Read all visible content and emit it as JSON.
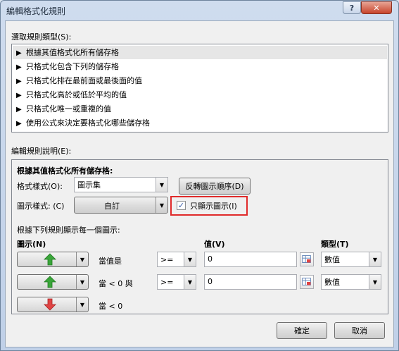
{
  "window": {
    "title": "編輯格式化規則",
    "help_label": "?",
    "close_label": "✕"
  },
  "rule_type": {
    "label": "選取規則類型(S):",
    "items": [
      {
        "label": "根據其值格式化所有儲存格",
        "selected": true
      },
      {
        "label": "只格式化包含下列的儲存格",
        "selected": false
      },
      {
        "label": "只格式化排在最前面或最後面的值",
        "selected": false
      },
      {
        "label": "只格式化高於或低於平均的值",
        "selected": false
      },
      {
        "label": "只格式化唯一或重複的值",
        "selected": false
      },
      {
        "label": "使用公式來決定要格式化哪些儲存格",
        "selected": false
      }
    ],
    "arrow_glyph": "▶"
  },
  "description": {
    "label": "編輯規則說明(E):",
    "heading": "根據其值格式化所有儲存格:",
    "format_style_label": "格式樣式(O):",
    "format_style_value": "圖示集",
    "reverse_order_label": "反轉圖示順序(D)",
    "icon_style_label": "圖示樣式: (C)",
    "icon_style_value": "自訂",
    "show_icon_only_label": "只顯示圖示(I)",
    "show_icon_only_checked": true,
    "check_glyph": "✓",
    "rules_heading": "根據下列規則顯示每一個圖示:",
    "col_icon": "圖示(N)",
    "col_value": "值(V)",
    "col_type": "類型(T)",
    "dropdown_glyph": "▼",
    "rows": [
      {
        "icon": "green-up-arrow",
        "condition": "當值是",
        "operator": ">=",
        "value": "0",
        "type": "數值"
      },
      {
        "icon": "green-up-arrow",
        "condition": "當 < 0 與",
        "operator": ">=",
        "value": "0",
        "type": "數值"
      },
      {
        "icon": "red-down-arrow",
        "condition": "當 < 0"
      }
    ]
  },
  "footer": {
    "ok_label": "確定",
    "cancel_label": "取消"
  },
  "colors": {
    "arrow_green": "#3aa53a",
    "arrow_red": "#e04444",
    "highlight_red": "#e02a2a"
  }
}
